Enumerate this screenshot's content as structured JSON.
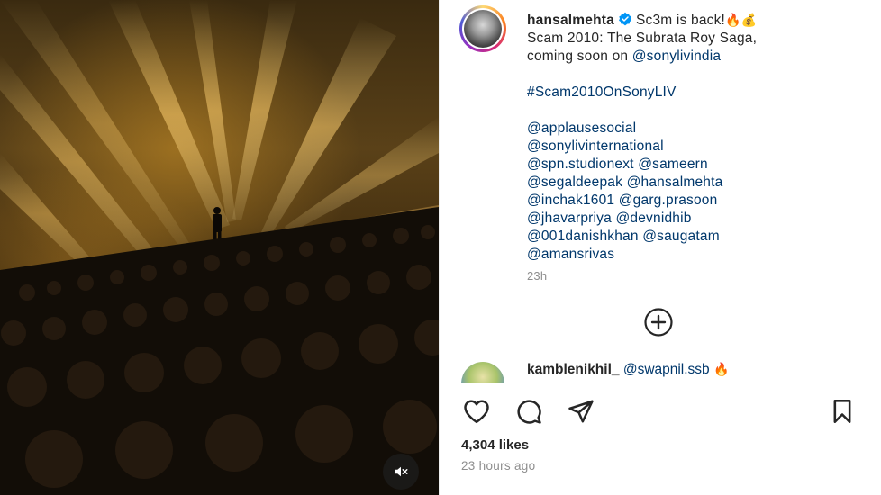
{
  "media": {
    "mute_icon": "speaker-muted-icon"
  },
  "post": {
    "username": "hansalmehta",
    "verified_icon": "verified-badge-icon",
    "caption": {
      "line1_text": "Sc3m is back!",
      "line1_emojis": "🔥💰",
      "line2": "Scam 2010: The Subrata Roy Saga,",
      "line3_prefix": "coming soon on",
      "line3_mention": "@sonylivindia",
      "hashtag": "#Scam2010OnSonyLIV",
      "mentions": [
        [
          "@applausesocial"
        ],
        [
          "@sonylivinternational"
        ],
        [
          "@spn.studionext",
          "@sameern"
        ],
        [
          "@segaldeepak",
          "@hansalmehta"
        ],
        [
          "@inchak1601",
          "@garg.prasoon"
        ],
        [
          "@jhavarpriya",
          "@devnidhib"
        ],
        [
          "@001danishkhan",
          "@saugatam"
        ],
        [
          "@amansrivas"
        ]
      ],
      "time": "23h"
    },
    "load_more_icon": "plus-circle-icon",
    "comment": {
      "username": "kamblenikhil_",
      "mention": "@swapnil.ssb",
      "emoji": "🔥"
    },
    "likes": "4,304 likes",
    "posted_ago": "23 hours ago"
  },
  "actions": {
    "like_icon": "heart-icon",
    "comment_icon": "comment-bubble-icon",
    "share_icon": "paper-plane-icon",
    "save_icon": "bookmark-icon"
  }
}
